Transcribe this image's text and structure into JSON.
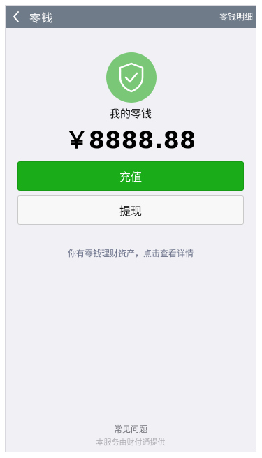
{
  "header": {
    "title": "零钱",
    "detail_label": "零钱明细",
    "back_icon": "chevron-left-icon"
  },
  "wallet": {
    "icon": "shield-check-icon",
    "label": "我的零钱",
    "balance": "￥8888.88"
  },
  "actions": {
    "recharge_label": "充值",
    "withdraw_label": "提现"
  },
  "hint": {
    "text": "你有零钱理财资产，点击查看详情"
  },
  "footer": {
    "faq_label": "常见问题",
    "provider_text": "本服务由财付通提供"
  },
  "colors": {
    "header_bg": "#6f7b89",
    "primary_green": "#1aad19",
    "shield_green": "#7ac877",
    "page_bg": "#f0f0f5"
  }
}
